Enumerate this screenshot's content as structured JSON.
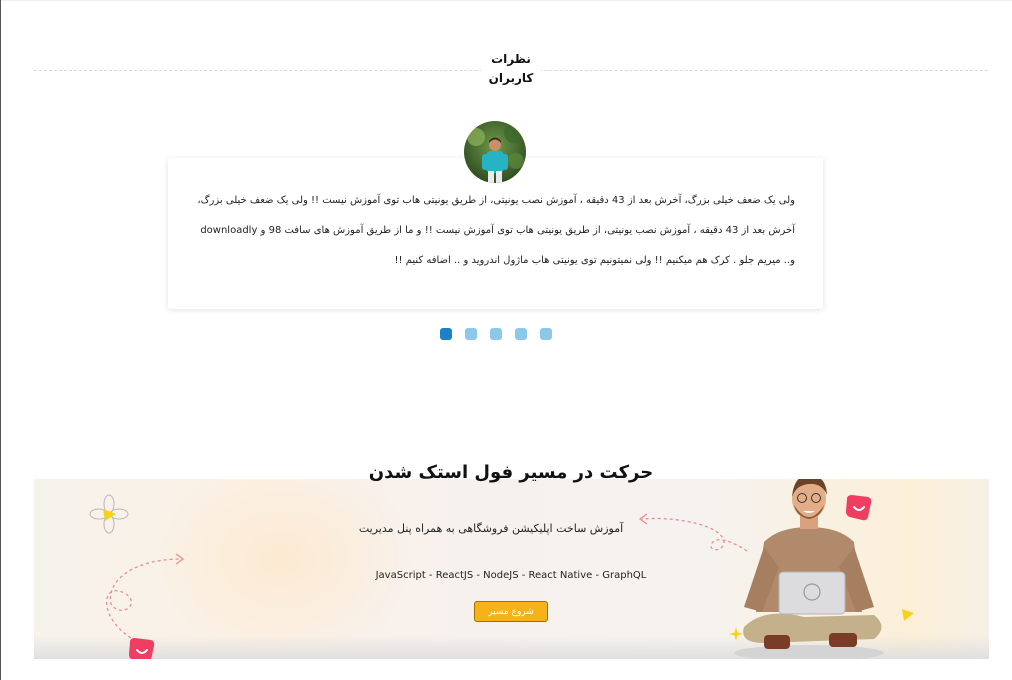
{
  "testimonials": {
    "section_title_line1": "نظرات",
    "section_title_line2": "کاربران",
    "active_index": 0,
    "total": 5,
    "quote": "ولی یک ضعف خیلی بزرگ، آخرش بعد از 43 دقیقه ، آموزش نصب یونیتی، از طریق یونیتی هاب توی آموزش نیست !! ولی یک ضعف خیلی بزرگ، آخرش بعد از 43 دقیقه ، آموزش نصب یونیتی، از طریق یونیتی هاب توی آموزش نیست !! و ما از طریق آموزش های سافت 98 و downloadly و.. میریم جلو . کرک هم میکنیم !! ولی نمیتونیم توی یونیتی هاب ماژول اندروید و .. اضافه کنیم !!"
  },
  "banner": {
    "title": "حرکت در مسیر فول استک شدن",
    "subtitle": "آموزش ساخت اپلیکیشن فروشگاهی به همراه پنل مدیریت",
    "tech_list": "JavaScript - ReactJS - NodeJS - React Native - GraphQL",
    "button_label": "شروع مسیر"
  },
  "colors": {
    "dot_active": "#1b82c5",
    "dot_inactive": "#8cc8e8",
    "button_bg": "#f6b21b",
    "badge_pink": "#ee3f63",
    "star_yellow": "#f7d21c"
  },
  "icons": [
    "user-avatar",
    "heart-badge-icon",
    "arrow-decoration-icon",
    "star-icon",
    "flower-icon"
  ]
}
